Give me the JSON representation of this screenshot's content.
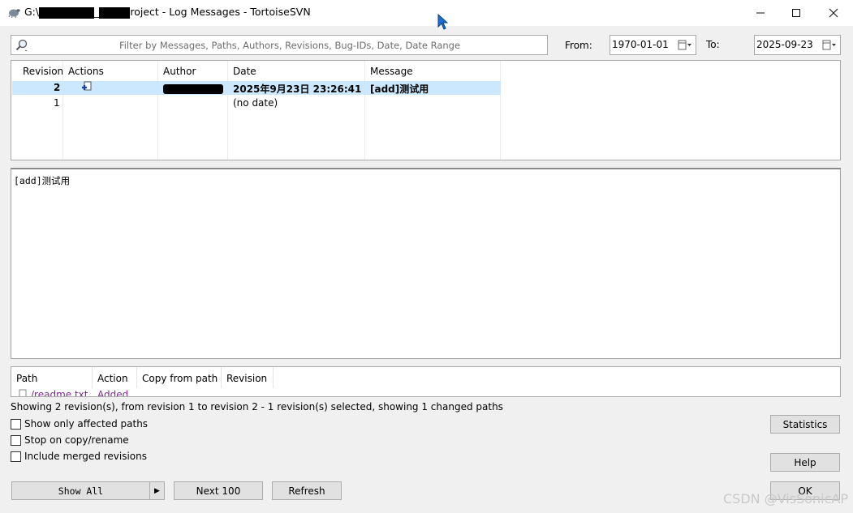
{
  "window": {
    "title_prefix": "G:\\",
    "title_mid": "_",
    "title_suffix": "roject - Log Messages - TortoiseSVN",
    "minimize_icon": "minimize-icon",
    "maximize_icon": "maximize-icon",
    "close_icon": "close-icon"
  },
  "filter": {
    "placeholder": "Filter by Messages, Paths, Authors, Revisions, Bug-IDs, Date, Date Range",
    "from_label": "From:",
    "from_value": "1970-01-01",
    "to_label": "To:",
    "to_value": "2025-09-23"
  },
  "revisions": {
    "headers": [
      "Revision",
      "Actions",
      "Author",
      "Date",
      "Message"
    ],
    "rows": [
      {
        "revision": "2",
        "date": "2025年9月23日 23:26:41",
        "message": "[add]测试用",
        "selected": true
      },
      {
        "revision": "1",
        "date": "(no date)",
        "message": ""
      }
    ]
  },
  "message_pane": {
    "text": "[add]测试用"
  },
  "paths": {
    "headers": [
      "Path",
      "Action",
      "Copy from path",
      "Revision"
    ],
    "rows": [
      {
        "path": "/readme.txt",
        "action": "Added"
      }
    ]
  },
  "status_text": "Showing 2 revision(s), from revision 1 to revision 2 - 1 revision(s) selected, showing 1 changed paths",
  "options": {
    "show_affected": "Show only affected paths",
    "stop_copy": "Stop on copy/rename",
    "include_merged": "Include merged revisions"
  },
  "buttons": {
    "show_all": "Show All",
    "next_100": "Next 100",
    "refresh": "Refresh",
    "statistics": "Statistics",
    "help": "Help",
    "ok": "OK"
  },
  "watermark": "CSDN @VisSonicAP",
  "colors": {
    "selection": "#cce8ff",
    "added_text": "#7a2a8a"
  }
}
